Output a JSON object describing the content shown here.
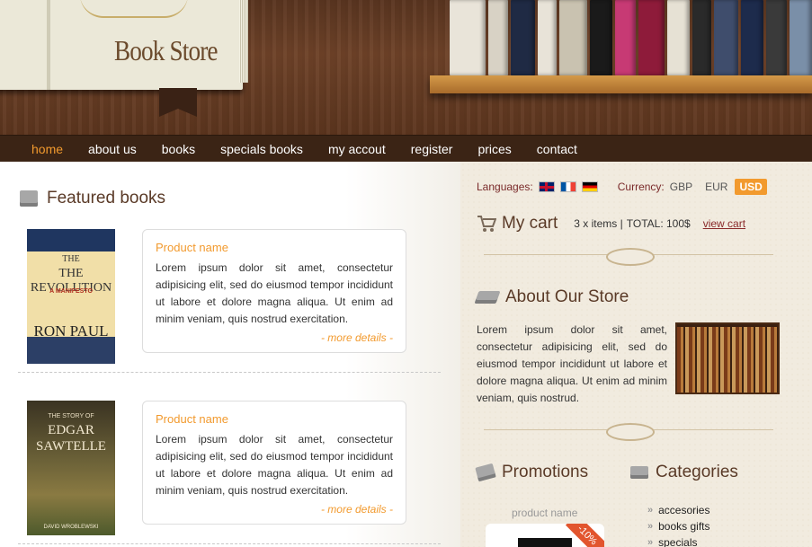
{
  "header": {
    "logo_title": "Book Store"
  },
  "nav": [
    {
      "label": "home",
      "active": true
    },
    {
      "label": "about us"
    },
    {
      "label": "books"
    },
    {
      "label": "specials books"
    },
    {
      "label": "my accout"
    },
    {
      "label": "register"
    },
    {
      "label": "prices"
    },
    {
      "label": "contact"
    }
  ],
  "featured": {
    "title": "Featured books",
    "items": [
      {
        "cover_title": "THE REVOLUTION",
        "cover_subtitle": "A MANIFESTO",
        "cover_author": "RON PAUL",
        "product_name": "Product name",
        "description": "Lorem ipsum dolor sit amet, consectetur adipisicing elit, sed do eiusmod tempor incididunt ut labore et dolore magna aliqua. Ut enim ad minim veniam, quis nostrud exercitation.",
        "more": "- more details -"
      },
      {
        "cover_title": "EDGAR SAWTELLE",
        "cover_subtitle": "THE STORY OF",
        "cover_author": "DAVID WROBLEWSKI",
        "product_name": "Product name",
        "description": "Lorem ipsum dolor sit amet, consectetur adipisicing elit, sed do eiusmod tempor incididunt ut labore et dolore magna aliqua. Ut enim ad minim veniam, quis nostrud exercitation.",
        "more": "- more details -"
      }
    ]
  },
  "sidebar": {
    "languages_label": "Languages:",
    "currency_label": "Currency:",
    "currencies": [
      "GBP",
      "EUR",
      "USD"
    ],
    "cart": {
      "title": "My cart",
      "items": "3 x items |",
      "total": "TOTAL: 100$",
      "view": "view cart"
    },
    "about": {
      "title": "About Our Store",
      "text": "Lorem ipsum dolor sit amet, consectetur adipisicing elit, sed do eiusmod tempor incididunt ut labore et dolore magna aliqua. Ut enim ad minim veniam, quis nostrud."
    },
    "promotions": {
      "title": "Promotions",
      "product_name": "product name",
      "discount": "-10%"
    },
    "categories": {
      "title": "Categories",
      "items": [
        "accesories",
        "books gifts",
        "specials"
      ]
    }
  },
  "colors": {
    "accent": "#f29a2e",
    "nav_bg": "#3b2415",
    "heading": "#5a3a27",
    "sidebar_bg": "#f1ebdf"
  }
}
